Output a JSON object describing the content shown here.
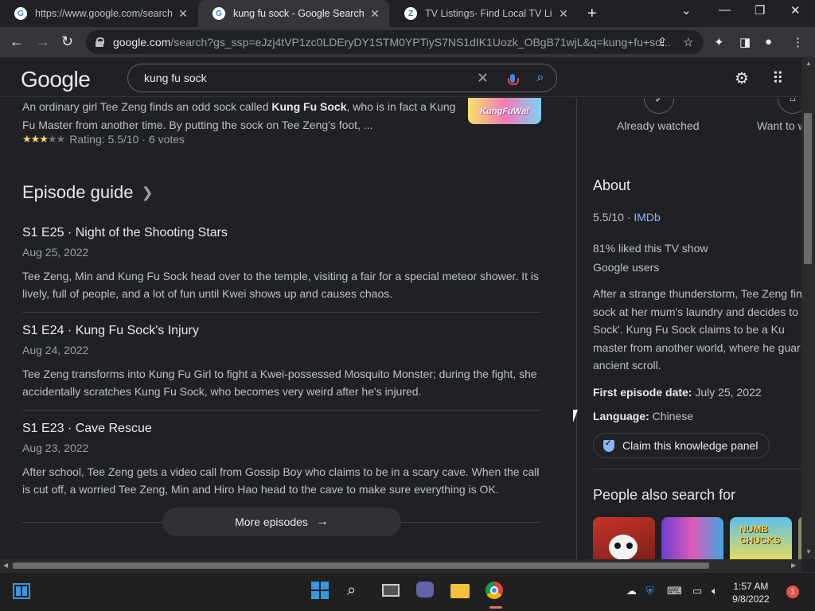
{
  "browser": {
    "tabs": [
      {
        "title": "https://www.google.com/search?",
        "favicon": "google-icon",
        "active": false
      },
      {
        "title": "kung fu sock - Google Search",
        "favicon": "google-icon",
        "active": true
      },
      {
        "title": "TV Listings- Find Local TV Listings",
        "favicon": "zap2it-icon",
        "active": false
      }
    ],
    "url_host": "google.com",
    "url_path": "/search?gs_ssp=eJzj4tVP1zc0LDEryDY1STM0YPTiyS7NS1dIK1Uozk_OBgB71wjL&q=kung+fu+so..."
  },
  "google": {
    "logo": "Google",
    "query": "kung fu sock"
  },
  "result": {
    "snippet_pre": "An ordinary girl Tee Zeng finds an odd sock called ",
    "snippet_bold": "Kung Fu Sock",
    "snippet_post": ", who is in fact a Kung Fu Master from another time. By putting the sock on Tee Zeng's foot, ...",
    "thumb_text": "KungFuWa!",
    "rating_text": "Rating: 5.5/10 · 6 votes",
    "rating_stars": 3
  },
  "episode_guide": {
    "heading": "Episode guide",
    "episodes": [
      {
        "code": "S1 E25",
        "name": "Night of the Shooting Stars",
        "date": "Aug 25, 2022",
        "desc": "Tee Zeng, Min and Kung Fu Sock head over to the temple, visiting a fair for a special meteor shower. It is lively, full of people, and a lot of fun until Kwei shows up and causes chaos."
      },
      {
        "code": "S1 E24",
        "name": "Kung Fu Sock's Injury",
        "date": "Aug 24, 2022",
        "desc": "Tee Zeng transforms into Kung Fu Girl to fight a Kwei-possessed Mosquito Monster; during the fight, she accidentally scratches Kung Fu Sock, who becomes very weird after he's injured."
      },
      {
        "code": "S1 E23",
        "name": "Cave Rescue",
        "date": "Aug 23, 2022",
        "desc": "After school, Tee Zeng gets a video call from Gossip Boy who claims to be in a scary cave. When the call is cut off, a worried Tee Zeng, Min and Hiro Hao head to the cave to make sure everything is OK."
      }
    ],
    "more_label": "More episodes"
  },
  "knowledge_panel": {
    "already_watched": "Already watched",
    "want_to": "Want to w",
    "about_heading": "About",
    "imdb_score": "5.5/10 · ",
    "imdb_label": "IMDb",
    "liked": "81% liked this TV show",
    "liked_source": "Google users",
    "summary": "After a strange thunderstorm, Tee Zeng fin sock at her mum's laundry and decides to Fu Sock'. Kung Fu Sock claims to be a Ku master from another world, where he guar ancient scroll.",
    "first_episode_label": "First episode date:",
    "first_episode_value": " July 25, 2022",
    "language_label": "Language:",
    "language_value": " Chinese",
    "claim_label": "Claim this knowledge panel",
    "people_heading": "People also search for"
  },
  "taskbar": {
    "time": "1:57 AM",
    "date": "9/8/2022",
    "notifications": "1"
  },
  "colors": {
    "background": "#202124",
    "link": "#8ab4f8",
    "star": "#fdd663",
    "windows_blue": "#3a96dd"
  }
}
